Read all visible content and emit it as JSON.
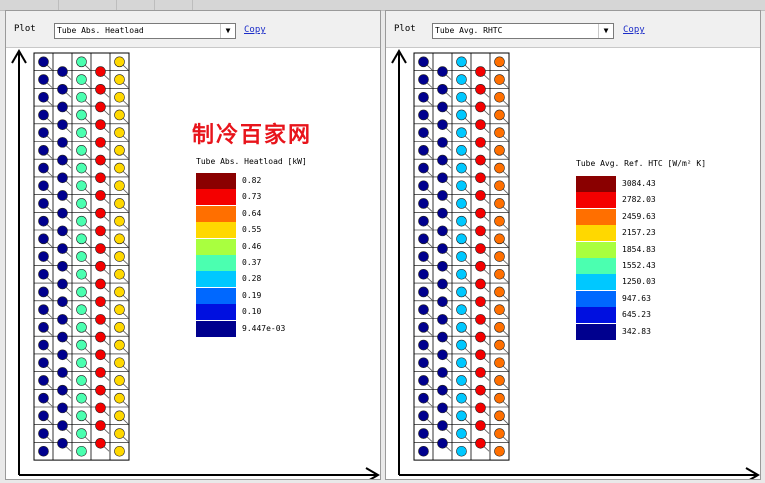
{
  "panels": [
    {
      "plot_label": "Plot",
      "select_value": "Tube Abs. Heatload",
      "copy_label": "Copy",
      "legend_title": "Tube Abs. Heatload [kW]",
      "legend_values": [
        "0.82",
        "0.73",
        "0.64",
        "0.55",
        "0.46",
        "0.37",
        "0.28",
        "0.19",
        "0.10",
        "9.447e-03"
      ]
    },
    {
      "plot_label": "Plot",
      "select_value": "Tube Avg. RHTC",
      "copy_label": "Copy",
      "legend_title": "Tube Avg. Ref. HTC [W/m² K]",
      "legend_values": [
        "3084.43",
        "2782.03",
        "2459.63",
        "2157.23",
        "1854.83",
        "1552.43",
        "1250.03",
        "947.63",
        "645.23",
        "342.83"
      ]
    }
  ],
  "watermark": "制冷百家网",
  "colors": {
    "scale": [
      "#8a0000",
      "#f40000",
      "#ff6f00",
      "#ffd800",
      "#a9ff3f",
      "#4bffb0",
      "#00c8ff",
      "#0068ff",
      "#0010e0",
      "#00008e"
    ],
    "link": "#1b2cc8"
  }
}
